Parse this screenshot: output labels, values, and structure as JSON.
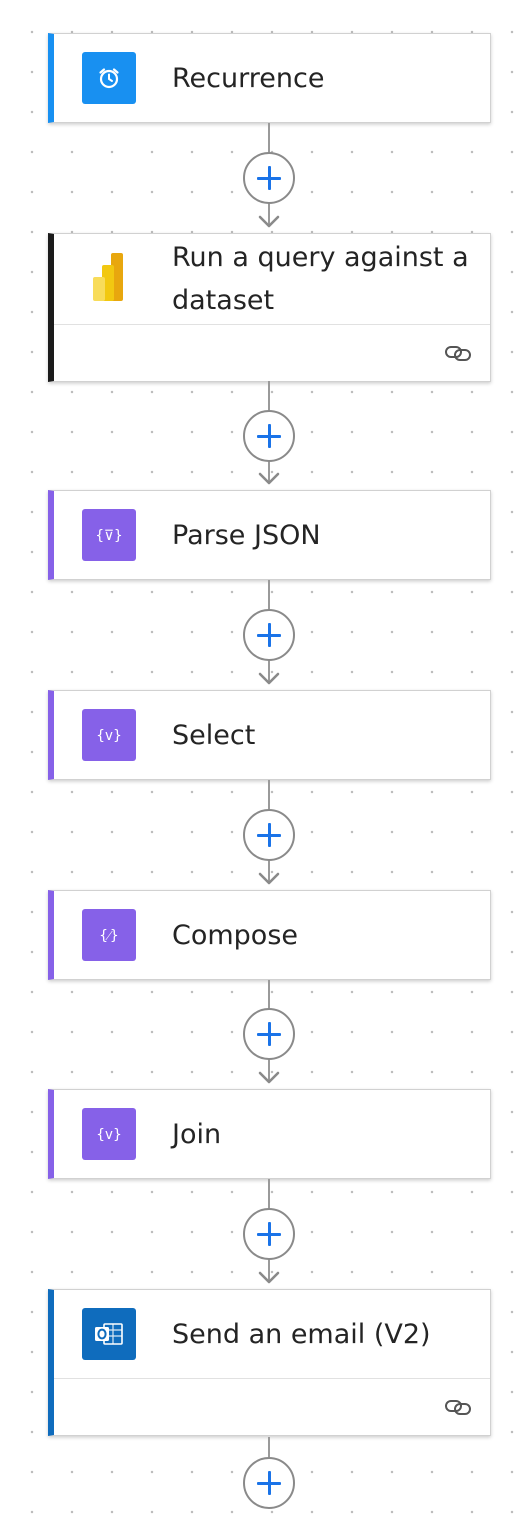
{
  "flow": {
    "steps": [
      {
        "title": "Recurrence",
        "icon": "alarm-clock-icon",
        "accent": "#1890f1"
      },
      {
        "title": "Run a query against a dataset",
        "icon": "power-bi-icon",
        "accent": "#1b1b1b",
        "footer_icon": "link-icon"
      },
      {
        "title": "Parse JSON",
        "icon": "data-operation-icon",
        "accent": "#8661e8"
      },
      {
        "title": "Select",
        "icon": "data-operation-icon",
        "accent": "#8661e8"
      },
      {
        "title": "Compose",
        "icon": "data-operation-icon",
        "accent": "#8661e8"
      },
      {
        "title": "Join",
        "icon": "data-operation-icon",
        "accent": "#8661e8"
      },
      {
        "title": "Send an email (V2)",
        "icon": "outlook-icon",
        "accent": "#0f6cbd",
        "footer_icon": "link-icon"
      }
    ],
    "add_action_icon": "plus-icon",
    "colors": {
      "plus": "#1a73e8",
      "connector": "#9a9a9a",
      "data_operation_icon_bg": "#8661e8",
      "recurrence_icon_bg": "#1890f1",
      "outlook_icon_bg": "#0f6cbd",
      "powerbi_yellow": "#f2c811"
    }
  }
}
